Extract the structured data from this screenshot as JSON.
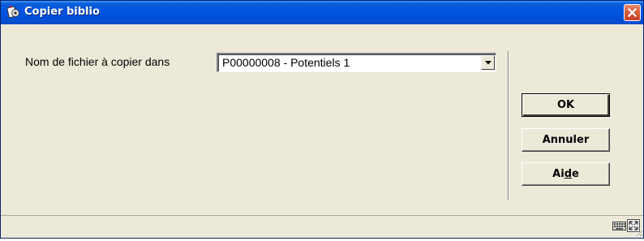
{
  "window": {
    "title": "Copier biblio",
    "title_icon": "catalog-app-icon",
    "close_icon": "close-icon"
  },
  "form": {
    "label": "Nom de fichier à copier dans",
    "select_value": "P00000008 - Potentiels 1",
    "select_arrow_icon": "chevron-down-icon"
  },
  "buttons": {
    "ok": "OK",
    "cancel": "Annuler",
    "help_prefix": "Ai",
    "help_mnemonic": "d",
    "help_suffix": "e"
  },
  "status": {
    "keyboard_icon": "keyboard-icon",
    "resize_icon": "resize-icon",
    "grip_icon": "resize-grip-icon"
  },
  "colors": {
    "titlebar": "#0054e3",
    "dialog_background": "#ece9d8",
    "close_button": "#d85a3a"
  }
}
